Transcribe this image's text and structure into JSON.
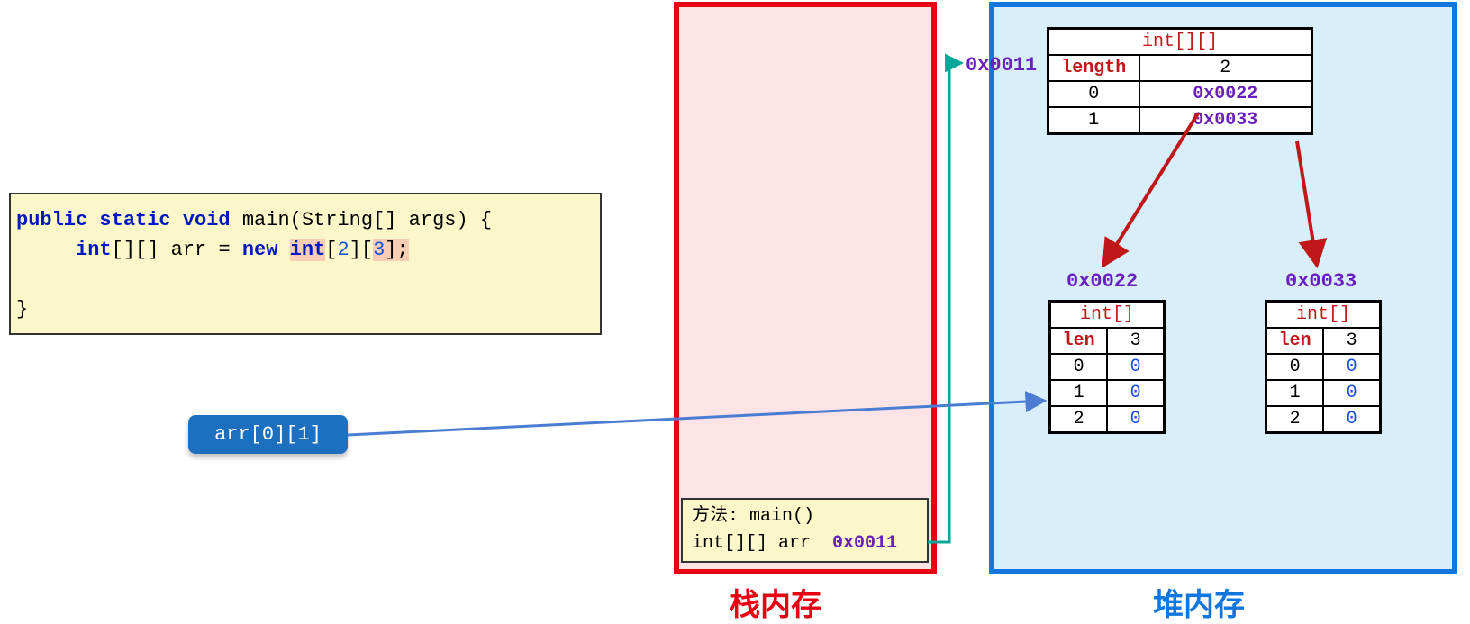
{
  "code": {
    "line1_pre": "public static void ",
    "line1_mid": "main(String[] args) {",
    "line2_indent": "     ",
    "line2_kw1": "int",
    "line2_mid1": "[][] arr = ",
    "line2_kw2": "new ",
    "line2_kw3": "int",
    "line2_br1": "[",
    "line2_n1": "2",
    "line2_br2": "][",
    "line2_n2": "3",
    "line2_br3": "];",
    "line3": "",
    "line4": "}"
  },
  "pill": {
    "text": "arr[0][1]"
  },
  "stack": {
    "label": "栈内存",
    "frame_line1": "方法: main()",
    "frame_line2_a": "int[][] arr  ",
    "frame_line2_b": "0x0011"
  },
  "heap": {
    "label": "堆内存",
    "addr0011": "0x0011",
    "addr0022": "0x0022",
    "addr0033": "0x0033",
    "t0011": {
      "type": "int[][]",
      "len_lbl": "length",
      "len_val": "2",
      "rows": [
        {
          "idx": "0",
          "val": "0x0022"
        },
        {
          "idx": "1",
          "val": "0x0033"
        }
      ]
    },
    "t0022": {
      "type": "int[]",
      "len_lbl": "len",
      "len_val": "3",
      "rows": [
        {
          "idx": "0",
          "val": "0"
        },
        {
          "idx": "1",
          "val": "0"
        },
        {
          "idx": "2",
          "val": "0"
        }
      ]
    },
    "t0033": {
      "type": "int[]",
      "len_lbl": "len",
      "len_val": "3",
      "rows": [
        {
          "idx": "0",
          "val": "0"
        },
        {
          "idx": "1",
          "val": "0"
        },
        {
          "idx": "2",
          "val": "0"
        }
      ]
    }
  }
}
